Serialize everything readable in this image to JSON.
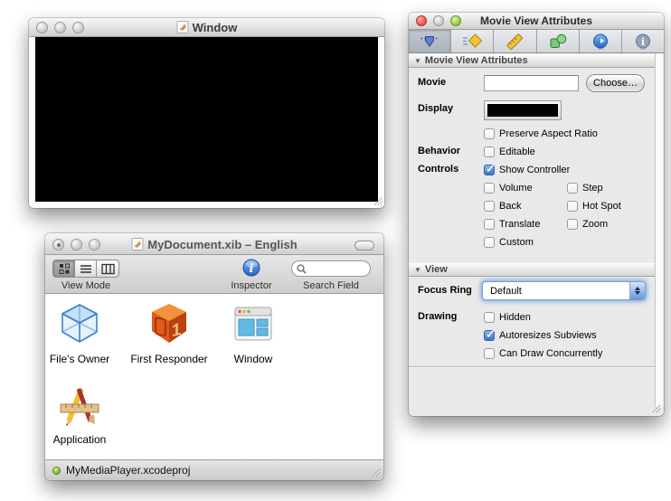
{
  "movie_window": {
    "title": "Window"
  },
  "doc_window": {
    "title": "MyDocument.xib – English",
    "toolbar": {
      "view_mode_label": "View Mode",
      "inspector_label": "Inspector",
      "search_label": "Search Field",
      "search_placeholder": ""
    },
    "items": {
      "files_owner": "File's Owner",
      "first_responder": "First Responder",
      "window": "Window",
      "application": "Application"
    },
    "status_text": "MyMediaPlayer.xcodeproj"
  },
  "inspector": {
    "window_title": "Movie View Attributes",
    "toolbar_icons": [
      "attributes-icon",
      "effects-icon",
      "size-icon",
      "bindings-icon",
      "connections-icon",
      "identity-icon"
    ],
    "section1_header": "Movie View Attributes",
    "movie_label": "Movie",
    "movie_value": "",
    "choose_button": "Choose…",
    "display_label": "Display",
    "behavior_label": "Behavior",
    "controls_label": "Controls",
    "checks": {
      "preserve_aspect_ratio": {
        "label": "Preserve Aspect Ratio",
        "checked": false
      },
      "editable": {
        "label": "Editable",
        "checked": false
      },
      "show_controller": {
        "label": "Show Controller",
        "checked": true
      },
      "volume": {
        "label": "Volume",
        "checked": false
      },
      "step": {
        "label": "Step",
        "checked": false
      },
      "back": {
        "label": "Back",
        "checked": false
      },
      "hot_spot": {
        "label": "Hot Spot",
        "checked": false
      },
      "translate": {
        "label": "Translate",
        "checked": false
      },
      "zoom": {
        "label": "Zoom",
        "checked": false
      },
      "custom": {
        "label": "Custom",
        "checked": false
      },
      "hidden": {
        "label": "Hidden",
        "checked": false
      },
      "autoresizes_subviews": {
        "label": "Autoresizes Subviews",
        "checked": true
      },
      "can_draw_concurrently": {
        "label": "Can Draw Concurrently",
        "checked": false
      }
    },
    "section2_header": "View",
    "focus_ring_label": "Focus Ring",
    "focus_ring_value": "Default",
    "drawing_label": "Drawing"
  },
  "colors": {
    "check_blue": "#3b79d1",
    "status_green": "#6fb52e",
    "focus_ring_blue": "#6ea0e6"
  }
}
